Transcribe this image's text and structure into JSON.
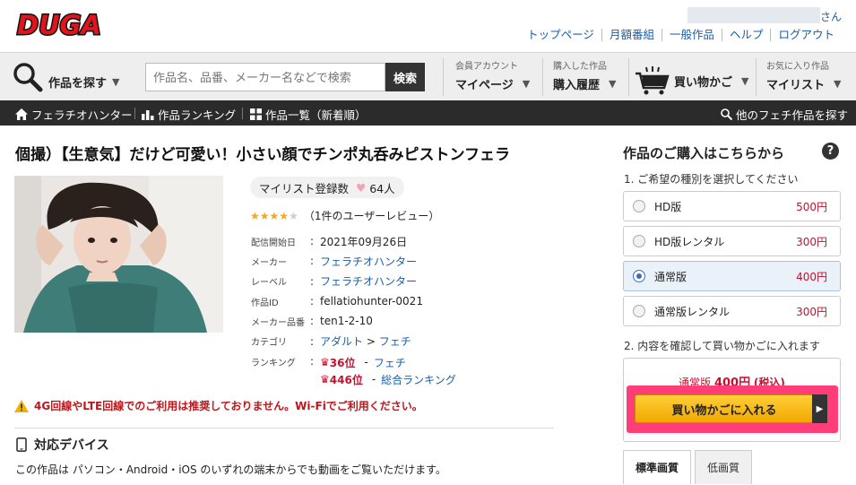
{
  "header": {
    "logo_text": "DUGA",
    "user_suffix": "さん",
    "links": [
      "トップページ",
      "月額番組",
      "一般作品",
      "ヘルプ",
      "ログアウト"
    ]
  },
  "nav": {
    "search_label": "作品を探す",
    "search_placeholder": "作品名、品番、メーカー名などで検索",
    "search_button": "検索",
    "account_small": "会員アカウント",
    "account_big": "マイページ",
    "history_small": "購入した作品",
    "history_big": "購入履歴",
    "cart_big": "買い物かご",
    "fav_small": "お気に入り作品",
    "fav_big": "マイリスト"
  },
  "subnav": {
    "maker": "フェラチオハンター",
    "ranking": "作品ランキング",
    "list": "作品一覧（新着順）",
    "other": "他のフェチ作品を探す"
  },
  "product": {
    "title": "個撮）【生意気】だけど可愛い！小さい顔でチンポ丸呑みピストンフェラ",
    "mylist_label": "マイリスト登録数",
    "mylist_count": "64人",
    "rating_stars": 4,
    "review_text": "（1件のユーザーレビュー）",
    "meta": {
      "release_label": "配信開始日",
      "release": "2021年09月26日",
      "maker_label": "メーカー",
      "maker": "フェラチオハンター",
      "label_label": "レーベル",
      "label": "フェラチオハンター",
      "id_label": "作品ID",
      "id": "fellatiohunter-0021",
      "code_label": "メーカー品番",
      "code": "ten1-2-10",
      "category_label": "カテゴリ",
      "category_1": "アダルト",
      "category_sep": ">",
      "category_2": "フェチ",
      "ranking_label": "ランキング",
      "rank1": "36位",
      "rank1_name": "フェチ",
      "rank2": "446位",
      "rank2_name": "総合ランキング"
    },
    "warning": "4G回線やLTE回線でのご利用は推奨しておりません。Wi-Fiでご利用ください。",
    "device_heading": "対応デバイス",
    "device_desc": "この作品は パソコン・Android・iOS のいずれの端末からでも動画をご覧いただけます。"
  },
  "purchase": {
    "title": "作品のご購入はこちらから",
    "help": "?",
    "step1": "1. ご希望の種別を選択してください",
    "options": [
      {
        "label": "HD版",
        "price": "500円",
        "selected": false
      },
      {
        "label": "HD版レンタル",
        "price": "300円",
        "selected": false
      },
      {
        "label": "通常版",
        "price": "400円",
        "selected": true
      },
      {
        "label": "通常版レンタル",
        "price": "300円",
        "selected": false
      }
    ],
    "step2": "2. 内容を確認して買い物かごに入れます",
    "summary_type": "通常版",
    "summary_price": "400円",
    "summary_tax": "(税込)",
    "cart_button": "買い物かごに入れる",
    "tab_active": "標準画質",
    "tab_inactive": "低画質"
  },
  "colors": {
    "accent_red": "#c8102e",
    "link_blue": "#1a5ea8",
    "cart_yellow": "#f9bd1a",
    "highlight_pink": "#ff3d79"
  }
}
